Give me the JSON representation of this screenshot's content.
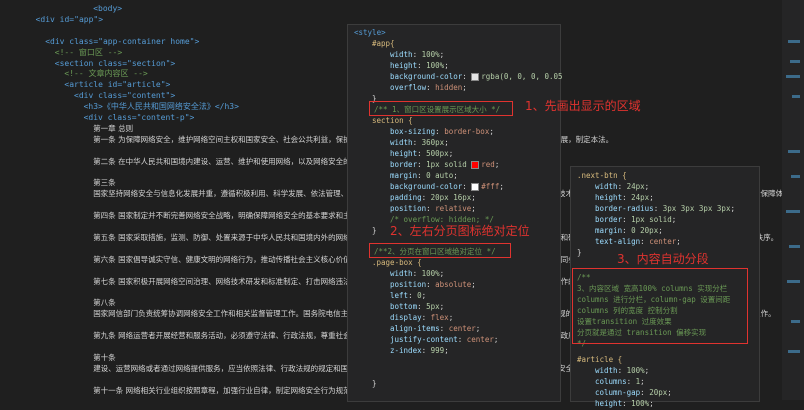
{
  "html_lines": [
    [
      "<body>"
    ],
    [
      "<div id=\"app\">"
    ],
    [
      ""
    ],
    [
      "<div class=\"app-container home\">"
    ],
    [
      "<!-- 窗口区 -->"
    ],
    [
      "<section class=\"section\">"
    ],
    [
      "<!-- 文章内容区 -->"
    ],
    [
      "<article id=\"article\">"
    ],
    [
      "<div class=\"content\">"
    ],
    [
      "<h3>《中华人民共和国网络安全法》</h3>"
    ],
    [
      "<div class=\"content-p\">"
    ],
    [
      "第一章 总则"
    ],
    [
      "第一条 为保障网络安全，维护网络空间主权和国家安全、社会公共利益，保护公民、法人和其他组织的合法权益，促进经济社会信息化健康发展，制定本法。"
    ],
    [
      ""
    ],
    [
      "第二条 在中华人民共和国境内建设、运营、维护和使用网络，以及网络安全的监督管理，适用本法。"
    ],
    [
      ""
    ],
    [
      "第三条"
    ],
    [
      "国家坚持网络安全与信息化发展并重，遵循积极利用、科学发展、依法管理、确保安全的方针，推进网络基础设施建设和互联互通，鼓励网络技术创新和应用，支持培养网络安全人才，建立健全网络安全保障体系，提高网络安全保护能力。"
    ],
    [
      ""
    ],
    [
      "第四条 国家制定并不断完善网络安全战略，明确保障网络安全的基本要求和主要目标，提出重点领域的网络安全政策、工作任务和措施。"
    ],
    [
      ""
    ],
    [
      "第五条 国家采取措施，监测、防御、处置来源于中华人民共和国境内外的网络安全风险和威胁，保护关键信息基础设施免受攻击、侵入、干扰和破坏，依法惩治网络违法犯罪活动，维护网络空间安全和秩序。"
    ],
    [
      ""
    ],
    [
      "第六条 国家倡导诚实守信、健康文明的网络行为，推动传播社会主义核心价值观，采取措施提高全社会的网络安全意识和水平，形成全社会共同参与促进网络安全的良好环境。"
    ],
    [
      ""
    ],
    [
      "第七条 国家积极开展网络空间治理、网络技术研发和标准制定、打击网络违法犯罪等方面的国际交流与合作，推动构建和平、安全、开放、合作的网络空间，建立多边、民主、透明的网络治理体系。"
    ],
    [
      ""
    ],
    [
      "第八条"
    ],
    [
      "国家网信部门负责统筹协调网络安全工作和相关监督管理工作。国务院电信主管部门、公安部门和其他有关机关依照本法和有关法律、行政法规的规定，在各自职责范围内负责网络安全保护和监督管理工作。"
    ],
    [
      ""
    ],
    [
      "第九条 网络运营者开展经营和服务活动，必须遵守法律、行政法规，尊重社会公德，遵守商业道德，诚实信用，履行网络安全保护义务，接受政府和社会的监督，承担社会责任。"
    ],
    [
      ""
    ],
    [
      "第十条"
    ],
    [
      "建设、运营网络或者通过网络提供服务，应当依照法律、行政法规的规定和国家标准的强制性要求，采取技术措施和其他必要措施，保障网络安全、稳定运行，有效应对网络安全事件。"
    ],
    [
      ""
    ],
    [
      "第十一条 网络相关行业组织按照章程，加强行业自律，制定网络安全行为规范。"
    ]
  ],
  "style_panel": {
    "open_tag": "<style>",
    "close": "}",
    "selector_app": "#app{",
    "width": [
      "width",
      "100%"
    ],
    "height": [
      "height",
      "100%"
    ],
    "background_color": [
      "background-color",
      "rgba(0, 0, 0, 0.05"
    ],
    "overflow": [
      "overflow",
      "hidden"
    ],
    "comment1": "/** 1、窗口区设置展示区域大小 */",
    "selector_section": "section {",
    "box_sizing": [
      "box-sizing",
      "border-box"
    ],
    "width2": [
      "width",
      "360px"
    ],
    "height2": [
      "height",
      "500px"
    ],
    "border": [
      "border",
      "1px solid",
      "red"
    ],
    "margin": [
      "margin",
      "0 auto"
    ],
    "background_color2": [
      "background-color",
      "#fff"
    ],
    "padding": [
      "padding",
      "20px 16px"
    ],
    "position": [
      "position",
      "relative"
    ],
    "overflow_comment": "/* overflow: hidden; */",
    "comment2": "/**2、分页在窗口区域绝对定位 */",
    "selector_pagebox": ".page-box {",
    "pb_width": [
      "width",
      "100%"
    ],
    "pb_position": [
      "position",
      "absolute"
    ],
    "pb_left": [
      "left",
      "0"
    ],
    "pb_bottom": [
      "bottom",
      "5px"
    ],
    "pb_display": [
      "display",
      "flex"
    ],
    "pb_align": [
      "align-items",
      "center"
    ],
    "pb_justify": [
      "justify-content",
      "center"
    ],
    "pb_z": [
      "z-index",
      "999"
    ]
  },
  "next_panel": {
    "selector": ".next-btn {",
    "width": [
      "width",
      "24px"
    ],
    "height": [
      "height",
      "24px"
    ],
    "radius": [
      "border-radius",
      "3px 3px 3px 3px"
    ],
    "border": [
      "border",
      "1px solid"
    ],
    "margin": [
      "margin",
      "0 20px"
    ],
    "text_align": [
      "text-align",
      "center"
    ],
    "close": "}",
    "comment3": [
      "/**",
      "3、内容区域 宽高100% columns 实现分栏",
      "columns 进行分栏，column-gap 设置间距",
      "columns 列的宽度 控制分割",
      "设置transition 过度效果",
      "分页就是通过 transition 偏移实现",
      "*/"
    ],
    "selector_article": "#article {",
    "a_width": [
      "width",
      "100%"
    ],
    "a_columns": [
      "columns",
      "1"
    ],
    "a_gap": [
      "column-gap",
      "20px"
    ],
    "a_height": [
      "height",
      "100%"
    ]
  },
  "annotations": {
    "note1": "1、先画出显示的区域",
    "note2": "2、左右分页图标绝对定位",
    "note3": "3、内容自动分段"
  },
  "colors": {
    "annotation": "#e0332f",
    "editor_bg": "#1f1f1f",
    "panel_bg": "#252526"
  }
}
